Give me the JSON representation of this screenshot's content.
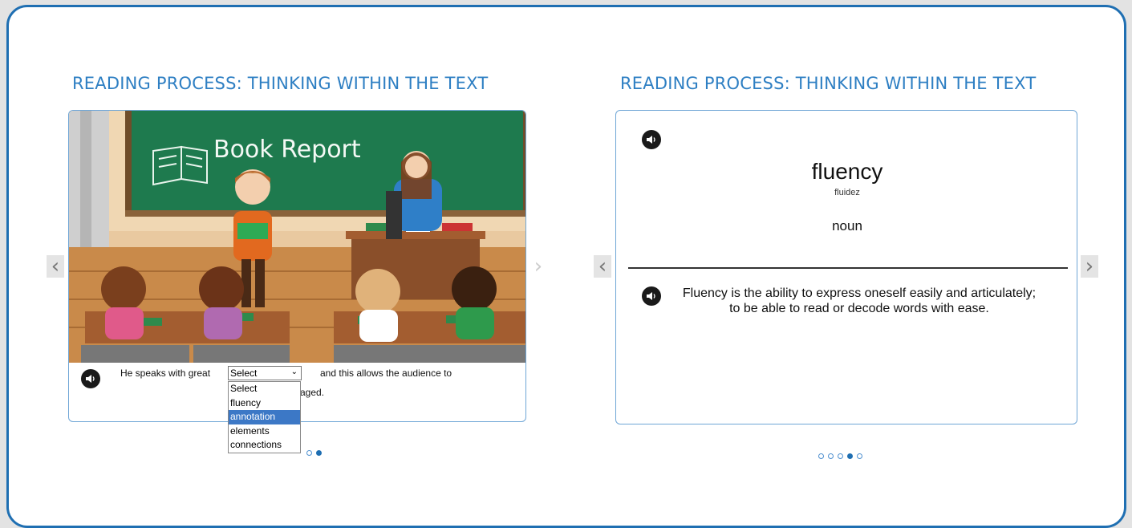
{
  "left_panel": {
    "title": "READING PROCESS: THINKING WITHIN THE TEXT",
    "board_text": "Book Report",
    "sentence_before": "He speaks with great",
    "sentence_after": "and this allows the audience to",
    "sentence_line2": "aged.",
    "select_value": "Select",
    "options": [
      "Select",
      "fluency",
      "annotation",
      "elements",
      "connections"
    ],
    "highlighted_option": "annotation",
    "prev_label": "‹",
    "next_label": "›"
  },
  "right_panel": {
    "title": "READING PROCESS: THINKING WITHIN THE TEXT",
    "word": "fluency",
    "translation": "fluidez",
    "part_of_speech": "noun",
    "definition": "Fluency is the ability to express oneself easily and articulately; to be able to read or decode words with ease.",
    "prev_label": "‹",
    "next_label": "›",
    "dots_total": 5,
    "active_dot": 3
  },
  "colors": {
    "accent": "#1f6fb2",
    "title_blue": "#2e7fc3",
    "chalkboard": "#1e7a4e",
    "wood": "#c98a4a"
  }
}
